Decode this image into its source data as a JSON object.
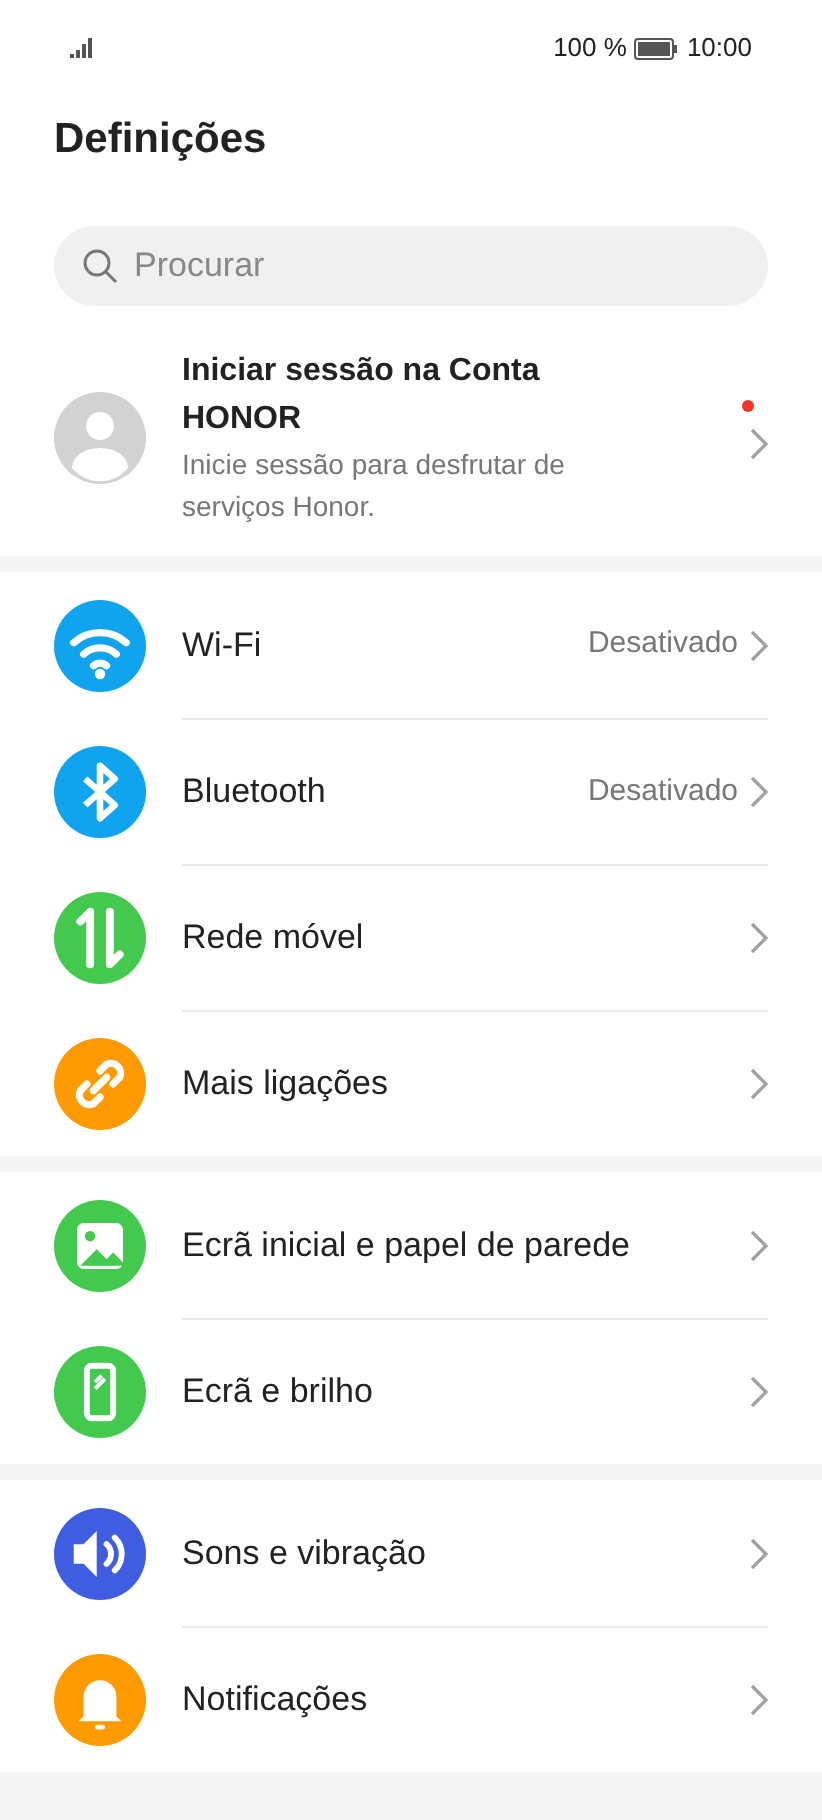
{
  "status_bar": {
    "battery_text": "100 %",
    "time": "10:00"
  },
  "title": "Definições",
  "search": {
    "placeholder": "Procurar"
  },
  "account": {
    "title": "Iniciar sessão na Conta HONOR",
    "subtitle": "Inicie sessão para desfrutar de serviços Honor.",
    "unread": true
  },
  "groups": [
    {
      "items": [
        {
          "kind": "wifi",
          "label": "Wi-Fi",
          "value": "Desativado",
          "color": "#10a3ee"
        },
        {
          "kind": "bluetooth",
          "label": "Bluetooth",
          "value": "Desativado",
          "color": "#10a3ee"
        },
        {
          "kind": "mobile",
          "label": "Rede móvel",
          "color": "#44c94f"
        },
        {
          "kind": "link",
          "label": "Mais ligações",
          "color": "#ff9b00"
        }
      ]
    },
    {
      "items": [
        {
          "kind": "wallpaper",
          "label": "Ecrã inicial e papel de parede",
          "color": "#44c94f"
        },
        {
          "kind": "display",
          "label": "Ecrã e brilho",
          "color": "#44c94f"
        }
      ]
    },
    {
      "items": [
        {
          "kind": "sound",
          "label": "Sons e vibração",
          "color": "#3e5de0"
        },
        {
          "kind": "bell",
          "label": "Notificações",
          "color": "#ff9b00"
        }
      ]
    }
  ]
}
